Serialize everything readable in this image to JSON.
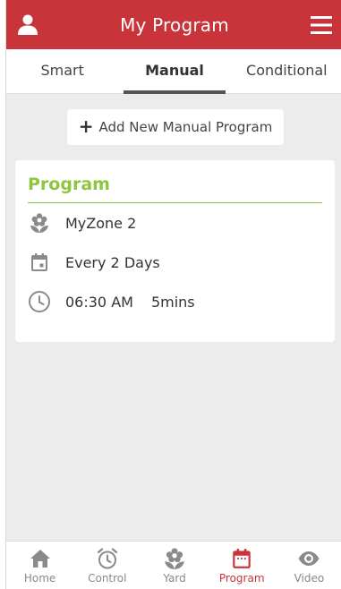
{
  "colors": {
    "brand": "#c9343a",
    "green": "#8cc63f",
    "icon_gray": "#8a8a8a",
    "background": "#ececec"
  },
  "header": {
    "title": "My Program",
    "left_icon": "user-icon",
    "right_icon": "menu-icon"
  },
  "tabs": [
    {
      "label": "Smart",
      "active": false
    },
    {
      "label": "Manual",
      "active": true
    },
    {
      "label": "Conditional",
      "active": false
    }
  ],
  "add_button": {
    "icon": "+",
    "label": "Add New Manual Program"
  },
  "program_card": {
    "title": "Program",
    "zone": {
      "icon": "flower-icon",
      "text": "MyZone 2"
    },
    "schedule": {
      "icon": "calendar-icon",
      "text": "Every 2 Days"
    },
    "time": {
      "icon": "clock-icon",
      "time": "06:30 AM",
      "duration": "5mins"
    }
  },
  "bottom_nav": [
    {
      "label": "Home",
      "icon": "home-icon",
      "active": false
    },
    {
      "label": "Control",
      "icon": "alarm-clock-icon",
      "active": false
    },
    {
      "label": "Yard",
      "icon": "flower-icon",
      "active": false
    },
    {
      "label": "Program",
      "icon": "calendar-icon",
      "active": true
    },
    {
      "label": "Video",
      "icon": "eye-icon",
      "active": false
    }
  ]
}
